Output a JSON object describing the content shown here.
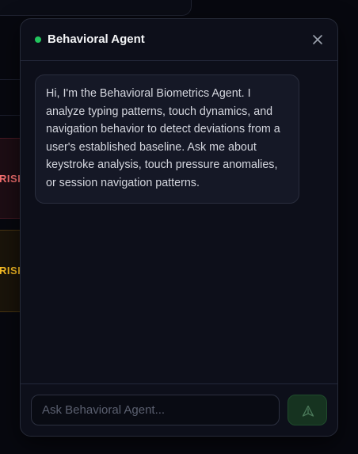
{
  "background": {
    "risk_cards": [
      {
        "label": "RISK",
        "color": "#f87171"
      },
      {
        "label": "RISK",
        "color": "#fbbf24"
      }
    ]
  },
  "chat": {
    "title": "Behavioral Agent",
    "status_color": "#22c55e",
    "close_icon": "close-icon",
    "messages": [
      {
        "role": "agent",
        "text": "Hi, I'm the Behavioral Biometrics Agent. I analyze typing patterns, touch dynamics, and navigation behavior to detect deviations from a user's established baseline. Ask me about keystroke analysis, touch pressure anomalies, or session navigation patterns."
      }
    ],
    "input": {
      "value": "",
      "placeholder": "Ask Behavioral Agent..."
    },
    "send_icon": "send-icon",
    "accent": "#163320"
  }
}
